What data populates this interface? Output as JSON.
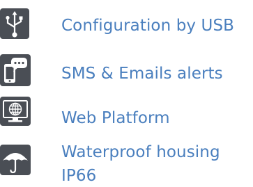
{
  "colors": {
    "icon_tile": "#4a4e55",
    "icon_glyph": "#ffffff",
    "text_accent": "#4a7fbe"
  },
  "features": [
    {
      "icon": "usb-icon",
      "label": "Configuration by USB"
    },
    {
      "icon": "phone-chat-icon",
      "label": "SMS & Emails alerts"
    },
    {
      "icon": "monitor-globe-icon",
      "label": "Web Platform"
    },
    {
      "icon": "umbrella-icon",
      "label_line1": "Waterproof housing",
      "label_line2": "IP66"
    }
  ]
}
